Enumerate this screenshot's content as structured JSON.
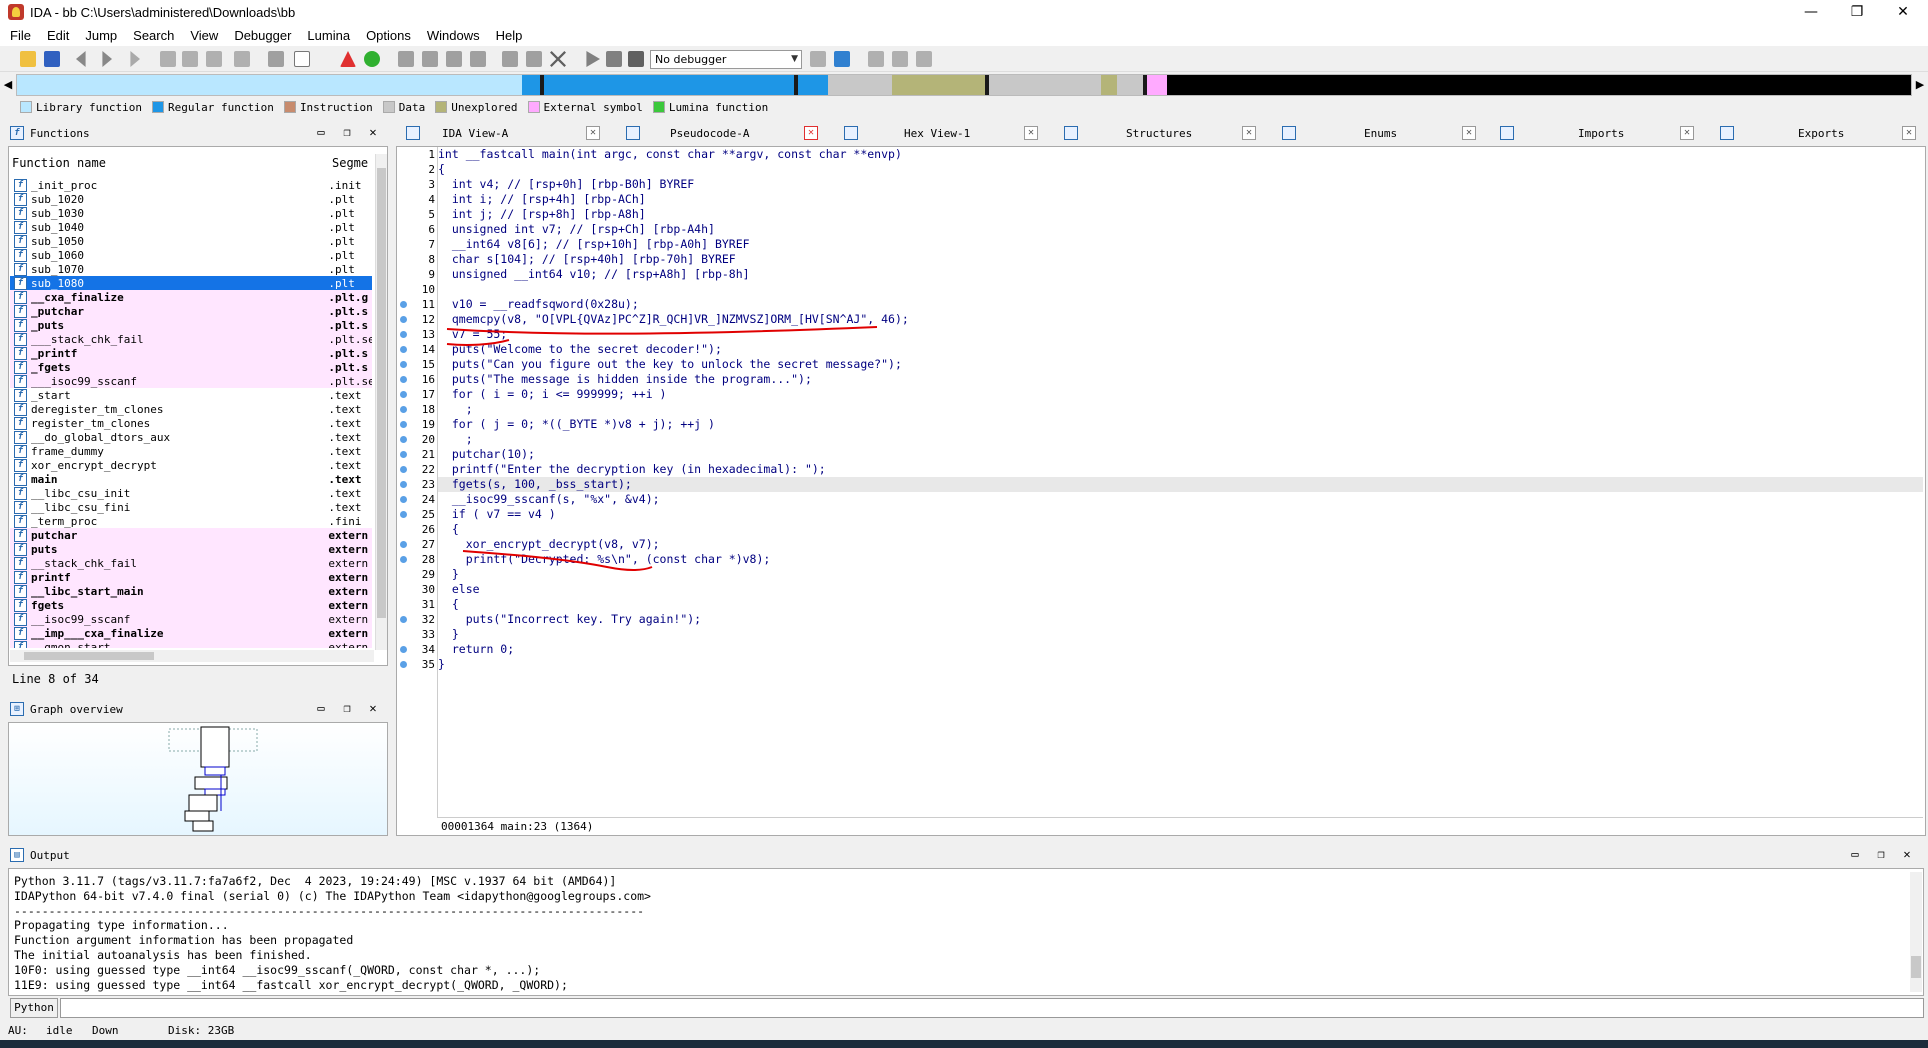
{
  "window": {
    "title": "IDA - bb C:\\Users\\administered\\Downloads\\bb",
    "minimize": "—",
    "maximize": "❐",
    "close": "✕"
  },
  "menu": [
    "File",
    "Edit",
    "Jump",
    "Search",
    "View",
    "Debugger",
    "Lumina",
    "Options",
    "Windows",
    "Help"
  ],
  "toolbar": {
    "debugger_select": "No debugger"
  },
  "legend": [
    {
      "label": "Library function",
      "color": "#b9e7ff"
    },
    {
      "label": "Regular function",
      "color": "#1e96e6"
    },
    {
      "label": "Instruction",
      "color": "#c88c6e"
    },
    {
      "label": "Data",
      "color": "#c8c8c8"
    },
    {
      "label": "Unexplored",
      "color": "#b4b478"
    },
    {
      "label": "External symbol",
      "color": "#ffaaff"
    },
    {
      "label": "Lumina function",
      "color": "#3cc83c"
    }
  ],
  "functions_panel": {
    "title": "Functions",
    "col_name": "Function name",
    "col_segment": "Segme",
    "status": "Line 8 of 34",
    "rows": [
      {
        "name": "_init_proc",
        "seg": ".init",
        "kind": "normal"
      },
      {
        "name": "sub_1020",
        "seg": ".plt",
        "kind": "normal"
      },
      {
        "name": "sub_1030",
        "seg": ".plt",
        "kind": "normal"
      },
      {
        "name": "sub_1040",
        "seg": ".plt",
        "kind": "normal"
      },
      {
        "name": "sub_1050",
        "seg": ".plt",
        "kind": "normal"
      },
      {
        "name": "sub_1060",
        "seg": ".plt",
        "kind": "normal"
      },
      {
        "name": "sub_1070",
        "seg": ".plt",
        "kind": "normal"
      },
      {
        "name": "sub_1080",
        "seg": ".plt",
        "kind": "selected"
      },
      {
        "name": "__cxa_finalize",
        "seg": ".plt.g",
        "kind": "libbold"
      },
      {
        "name": "_putchar",
        "seg": ".plt.s",
        "kind": "libbold"
      },
      {
        "name": "_puts",
        "seg": ".plt.s",
        "kind": "libbold"
      },
      {
        "name": "___stack_chk_fail",
        "seg": ".plt.se",
        "kind": "lib"
      },
      {
        "name": "_printf",
        "seg": ".plt.s",
        "kind": "libbold"
      },
      {
        "name": "_fgets",
        "seg": ".plt.s",
        "kind": "libbold"
      },
      {
        "name": "___isoc99_sscanf",
        "seg": ".plt.se",
        "kind": "lib"
      },
      {
        "name": "_start",
        "seg": ".text",
        "kind": "normal"
      },
      {
        "name": "deregister_tm_clones",
        "seg": ".text",
        "kind": "normal"
      },
      {
        "name": "register_tm_clones",
        "seg": ".text",
        "kind": "normal"
      },
      {
        "name": "__do_global_dtors_aux",
        "seg": ".text",
        "kind": "normal"
      },
      {
        "name": "frame_dummy",
        "seg": ".text",
        "kind": "normal"
      },
      {
        "name": "xor_encrypt_decrypt",
        "seg": ".text",
        "kind": "normal"
      },
      {
        "name": "main",
        "seg": ".text",
        "kind": "bold"
      },
      {
        "name": "__libc_csu_init",
        "seg": ".text",
        "kind": "normal"
      },
      {
        "name": "__libc_csu_fini",
        "seg": ".text",
        "kind": "normal"
      },
      {
        "name": "_term_proc",
        "seg": ".fini",
        "kind": "normal"
      },
      {
        "name": "putchar",
        "seg": "extern",
        "kind": "libbold"
      },
      {
        "name": "puts",
        "seg": "extern",
        "kind": "libbold"
      },
      {
        "name": "__stack_chk_fail",
        "seg": "extern",
        "kind": "lib"
      },
      {
        "name": "printf",
        "seg": "extern",
        "kind": "libbold"
      },
      {
        "name": "__libc_start_main",
        "seg": "extern",
        "kind": "libbold"
      },
      {
        "name": "fgets",
        "seg": "extern",
        "kind": "libbold"
      },
      {
        "name": "__isoc99_sscanf",
        "seg": "extern",
        "kind": "lib"
      },
      {
        "name": "__imp___cxa_finalize",
        "seg": "extern",
        "kind": "libbold"
      },
      {
        "name": "__gmon_start__",
        "seg": "extern",
        "kind": "lib"
      }
    ]
  },
  "graph_panel": {
    "title": "Graph overview"
  },
  "tabs": [
    {
      "label": "IDA View-A",
      "active": false
    },
    {
      "label": "Pseudocode-A",
      "active": true
    },
    {
      "label": "Hex View-1",
      "active": false
    },
    {
      "label": "Structures",
      "active": false
    },
    {
      "label": "Enums",
      "active": false
    },
    {
      "label": "Imports",
      "active": false
    },
    {
      "label": "Exports",
      "active": false
    }
  ],
  "code": {
    "lines": [
      "int __fastcall main(int argc, const char **argv, const char **envp)",
      "{",
      "  int v4; // [rsp+0h] [rbp-B0h] BYREF",
      "  int i; // [rsp+4h] [rbp-ACh]",
      "  int j; // [rsp+8h] [rbp-A8h]",
      "  unsigned int v7; // [rsp+Ch] [rbp-A4h]",
      "  __int64 v8[6]; // [rsp+10h] [rbp-A0h] BYREF",
      "  char s[104]; // [rsp+40h] [rbp-70h] BYREF",
      "  unsigned __int64 v10; // [rsp+A8h] [rbp-8h]",
      "",
      "  v10 = __readfsqword(0x28u);",
      "  qmemcpy(v8, \"O[VPL{QVAz]PC^Z]R_QCH]VR_]NZMVSZ]ORM_[HV[SN^AJ\", 46);",
      "  v7 = 55;",
      "  puts(\"Welcome to the secret decoder!\");",
      "  puts(\"Can you figure out the key to unlock the secret message?\");",
      "  puts(\"The message is hidden inside the program...\");",
      "  for ( i = 0; i <= 999999; ++i )",
      "    ;",
      "  for ( j = 0; *((_BYTE *)v8 + j); ++j )",
      "    ;",
      "  putchar(10);",
      "  printf(\"Enter the decryption key (in hexadecimal): \");",
      "  fgets(s, 100, _bss_start);",
      "  __isoc99_sscanf(s, \"%x\", &v4);",
      "  if ( v7 == v4 )",
      "  {",
      "    xor_encrypt_decrypt(v8, v7);",
      "    printf(\"Decrypted: %s\\n\", (const char *)v8);",
      "  }",
      "  else",
      "  {",
      "    puts(\"Incorrect key. Try again!\");",
      "  }",
      "  return 0;",
      "}"
    ],
    "status": "00001364 main:23 (1364)"
  },
  "output_panel": {
    "title": "Output",
    "lines": [
      "Python 3.11.7 (tags/v3.11.7:fa7a6f2, Dec  4 2023, 19:24:49) [MSC v.1937 64 bit (AMD64)]",
      "IDAPython 64-bit v7.4.0 final (serial 0) (c) The IDAPython Team <idapython@googlegroups.com>",
      "-------------------------------------------------------------------------------------------",
      "Propagating type information...",
      "Function argument information has been propagated",
      "The initial autoanalysis has been finished.",
      "10F0: using guessed type __int64 __isoc99_sscanf(_QWORD, const char *, ...);",
      "11E9: using guessed type __int64 __fastcall xor_encrypt_decrypt(_QWORD, _QWORD);"
    ],
    "python_label": "Python"
  },
  "statusbar": {
    "au": "AU:",
    "state": "idle",
    "direction": "Down",
    "disk": "Disk: 23GB"
  }
}
